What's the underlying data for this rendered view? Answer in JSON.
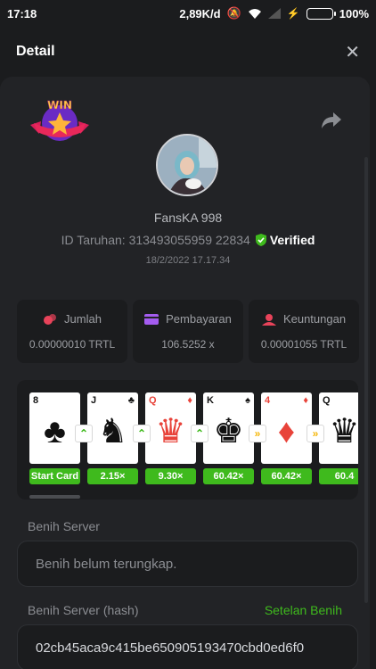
{
  "status_bar": {
    "time": "17:18",
    "network_speed": "2,89K/d",
    "battery": "100%"
  },
  "header": {
    "title": "Detail",
    "close_icon": "close-icon"
  },
  "profile": {
    "badge_text": "WIN",
    "username": "FansKA 998",
    "bet_id": "ID Taruhan: 313493055959 22834",
    "verified": "Verified",
    "date": "18/2/2022 17.17.34"
  },
  "stats": [
    {
      "label": "Jumlah",
      "value": "0.00000010 TRTL",
      "icon": "chips-icon",
      "color": "#e8435a"
    },
    {
      "label": "Pembayaran",
      "value": "106.5252 x",
      "icon": "card-icon",
      "color": "#a45cf0"
    },
    {
      "label": "Keuntungan",
      "value": "0.00001055 TRTL",
      "icon": "profit-icon",
      "color": "#e8435a"
    }
  ],
  "cards": [
    {
      "rank": "8",
      "suit": "♣",
      "color": "black",
      "multiplier": "Start Card"
    },
    {
      "rank": "J",
      "suit": "♣",
      "color": "black",
      "multiplier": "2.15×"
    },
    {
      "rank": "Q",
      "suit": "♦",
      "color": "red",
      "multiplier": "9.30×"
    },
    {
      "rank": "K",
      "suit": "♠",
      "color": "black",
      "multiplier": "60.42×"
    },
    {
      "rank": "4",
      "suit": "♦",
      "color": "red",
      "multiplier": "60.42×"
    },
    {
      "rank": "Q",
      "suit": "♠",
      "color": "black",
      "multiplier": "60.4"
    }
  ],
  "arrows": [
    "up",
    "up",
    "up",
    "skip",
    "skip"
  ],
  "seed": {
    "server_label": "Benih Server",
    "server_placeholder": "Benih belum terungkap.",
    "hash_label": "Benih Server (hash)",
    "settings_link": "Setelan Benih",
    "hash_value": "02cb45aca9c415be650905193470cbd0ed6f0"
  },
  "colors": {
    "accent": "#3fba1d",
    "background": "#1b1c1e",
    "panel": "#222326"
  }
}
